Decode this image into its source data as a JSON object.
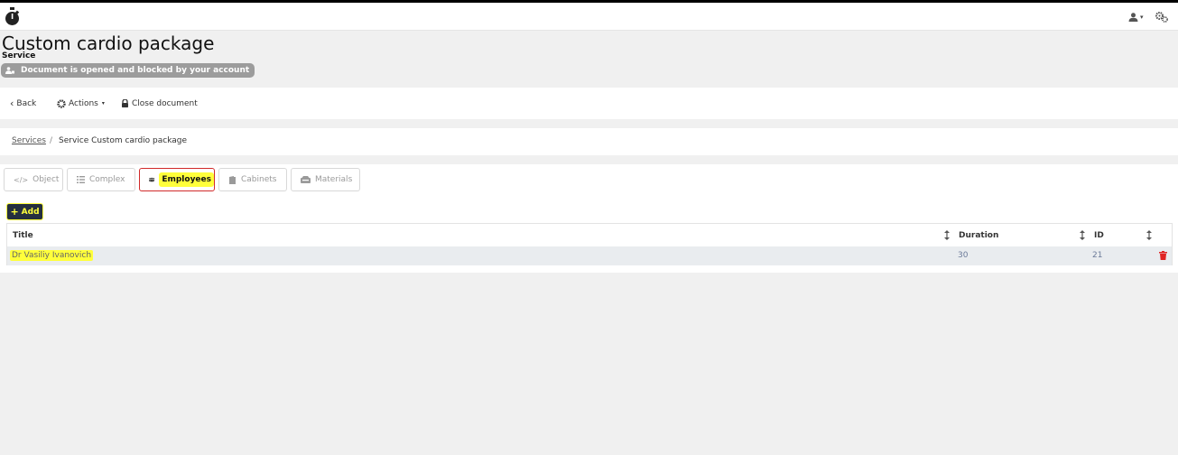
{
  "header": {
    "logo_icon": "stopwatch-icon",
    "user_icon": "user-icon",
    "settings_icon": "gears-icon"
  },
  "page": {
    "title": "Custom cardio package",
    "subtitle": "Service",
    "lock_badge": "Document is opened and blocked by your account"
  },
  "toolbar": {
    "back_label": "Back",
    "actions_label": "Actions",
    "close_label": "Close document"
  },
  "breadcrumb": {
    "link": "Services",
    "separator": "/",
    "current": "Service Custom cardio package"
  },
  "tabs": [
    {
      "label": "Object",
      "icon": "code-icon"
    },
    {
      "label": "Complex",
      "icon": "list-icon"
    },
    {
      "label": "Employees",
      "icon": "users-icon"
    },
    {
      "label": "Cabinets",
      "icon": "door-icon"
    },
    {
      "label": "Materials",
      "icon": "box-icon"
    }
  ],
  "add_button": {
    "label": "Add"
  },
  "table": {
    "columns": [
      "Title",
      "Duration",
      "ID"
    ],
    "rows": [
      {
        "title": "Dr Vasiliy Ivanovich",
        "duration": "30",
        "id": "21"
      }
    ]
  },
  "colors": {
    "highlight": "#ffff3b",
    "active_tab_border": "#d12a2a",
    "add_button_bg": "#252f3f",
    "delete": "#e02424",
    "badge_bg": "#9c9c9c"
  }
}
